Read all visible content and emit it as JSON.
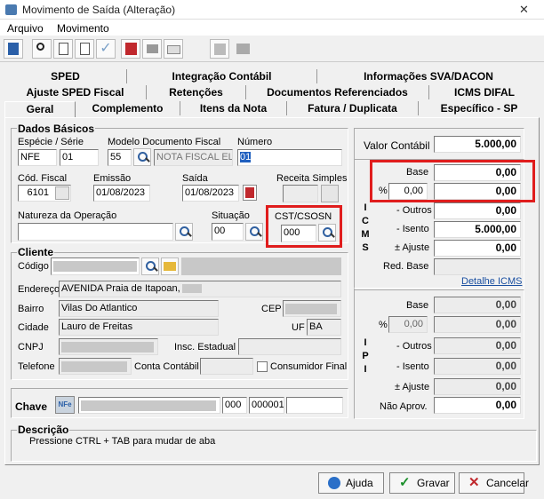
{
  "window": {
    "title": "Movimento de Saída (Alteração)",
    "close": "✕"
  },
  "menu": {
    "items": [
      "Arquivo",
      "Movimento"
    ]
  },
  "tabs": {
    "row1": [
      "SPED",
      "Integração Contábil",
      "Informações SVA/DACON"
    ],
    "row2": [
      "Ajuste SPED Fiscal",
      "Retenções",
      "Documentos Referenciados",
      "ICMS DIFAL"
    ],
    "row3": [
      "Geral",
      "Complemento",
      "Itens da Nota",
      "Fatura / Duplicata",
      "Específico - SP"
    ]
  },
  "dados_basicos": {
    "title": "Dados Básicos",
    "especie_serie_label": "Espécie  /  Série",
    "especie": "NFE",
    "serie": "01",
    "modelo_label": "Modelo Documento Fiscal",
    "modelo": "55",
    "modelo_desc": "NOTA FISCAL EL",
    "numero_label": "Número",
    "numero": "01",
    "cod_fiscal_label": "Cód. Fiscal",
    "cod_fiscal": "6101",
    "emissao_label": "Emissão",
    "emissao": "01/08/2023",
    "saida_label": "Saída",
    "saida": "01/08/2023",
    "receita_simples_label": "Receita Simples",
    "natureza_label": "Natureza da Operação",
    "natureza": "",
    "situacao_label": "Situação",
    "situacao": "00",
    "cst_label": "CST/CSOSN",
    "cst": "000"
  },
  "cliente": {
    "title": "Cliente",
    "codigo_label": "Código",
    "endereco_label": "Endereço",
    "endereco": "AVENIDA Praia de Itapoan,",
    "bairro_label": "Bairro",
    "bairro": "Vilas Do Atlantico",
    "cep_label": "CEP",
    "cidade_label": "Cidade",
    "cidade": "Lauro de Freitas",
    "uf_label": "UF",
    "uf": "BA",
    "cnpj_label": "CNPJ",
    "insc_label": "Insc. Estadual",
    "telefone_label": "Telefone",
    "conta_label": "Conta Contábil",
    "consumidor_label": "Consumidor Final"
  },
  "chave": {
    "label": "Chave",
    "nfe_icon": "NFe",
    "part1": "000",
    "part2": "000001"
  },
  "descricao": {
    "title": "Descrição",
    "text": "Pressione CTRL + TAB para  mudar de aba"
  },
  "valores": {
    "valor_contabil_label": "Valor Contábil",
    "valor_contabil": "5.000,00",
    "icms_letters": [
      "I",
      "C",
      "M",
      "S"
    ],
    "icms": {
      "base_label": "Base",
      "base": "0,00",
      "pct_label": "%",
      "aliq": "0,00",
      "valor": "0,00",
      "outros_label": "- Outros",
      "outros": "0,00",
      "isento_label": "- Isento",
      "isento": "5.000,00",
      "ajuste_label": "± Ajuste",
      "ajuste": "0,00",
      "red_base_label": "Red. Base",
      "detalhe_label": "Detalhe ICMS"
    },
    "ipi_letters": [
      "I",
      "P",
      "I"
    ],
    "ipi": {
      "base_label": "Base",
      "base": "0,00",
      "pct_label": "%",
      "aliq": "0,00",
      "valor": "0,00",
      "outros_label": "- Outros",
      "outros": "0,00",
      "isento_label": "- Isento",
      "isento": "0,00",
      "ajuste_label": "± Ajuste",
      "ajuste": "0,00",
      "nao_aprov_label": "Não Aprov.",
      "nao_aprov": "0,00"
    }
  },
  "buttons": {
    "ajuda": "Ajuda",
    "gravar": "Gravar",
    "cancelar": "Cancelar"
  },
  "colors": {
    "highlight": "#e01d1d",
    "link": "#1a4fa0",
    "selected": "#1f5fbf"
  }
}
